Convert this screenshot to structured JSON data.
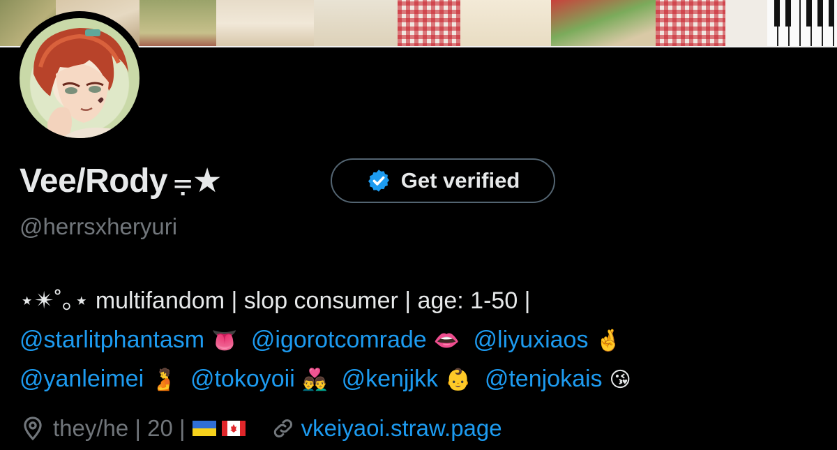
{
  "profile": {
    "display_name": "Vee/Rody",
    "name_decoration": "⩦★",
    "verify_button_label": "Get verified",
    "handle": "@herrsxheryuri"
  },
  "bio": {
    "line1": "⋆✴︎˚｡⋆ multifandom | slop consumer | age: 1-50 |",
    "line2": [
      {
        "mention": "@starlitphantasm",
        "emoji": "👅"
      },
      {
        "mention": "@igorotcomrade",
        "emoji": "👄"
      },
      {
        "mention": "@liyuxiaos",
        "emoji": "🤞"
      }
    ],
    "line3": [
      {
        "mention": "@yanleimei",
        "emoji": "🫄"
      },
      {
        "mention": "@tokoyoii",
        "emoji": "👨‍❤️‍👨"
      },
      {
        "mention": "@kenjjkk",
        "emoji": "👶"
      },
      {
        "mention": "@tenjokais",
        "emoji": "😘"
      }
    ]
  },
  "meta": {
    "location_icon": "location-pin-icon",
    "location_text": "they/he | 20 |",
    "flags": [
      "ukraine-flag",
      "canada-flag"
    ],
    "link_icon": "link-icon",
    "link_text": "vkeiyaoi.straw.page"
  },
  "colors": {
    "background": "#000000",
    "text_primary": "#e7e9ea",
    "text_secondary": "#71767b",
    "accent_link": "#1d9bf0",
    "verified_badge": "#1d9bf0",
    "button_border": "#536471"
  }
}
